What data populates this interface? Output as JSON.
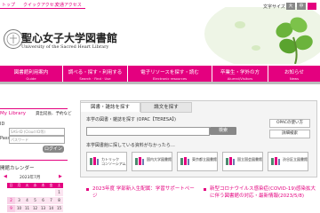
{
  "top_links": [
    "トップ",
    "クイックアクセス",
    "交通アクセス"
  ],
  "utility": {
    "font_size_label": "文字サイズ",
    "sizes": [
      "大",
      "中"
    ]
  },
  "logo": {
    "jp": "聖心女子大学図書館",
    "en": "University of the Sacred Heart Library"
  },
  "nav": [
    {
      "jp": "図書館利用案内",
      "en": "Guide"
    },
    {
      "jp": "調べる・探す・利用する",
      "en": "Search · Find · Use"
    },
    {
      "jp": "電子リソースを探す・読む",
      "en": "Electronic resources"
    },
    {
      "jp": "卒業生・学外の方",
      "en": "Alumni/Visitors"
    },
    {
      "jp": "お知らせ",
      "en": "News"
    }
  ],
  "sidebar": {
    "title": "My Library",
    "links": "貸出延長、予約など",
    "id_label": "ID",
    "id_placeholder": "SAS-ID (Cloud ID等)",
    "password_label": "Pass",
    "password_placeholder": "パスワード",
    "login": "ログイン",
    "calendar_title": "開館カレンダー",
    "month": "2023年7月",
    "weekdays": [
      "日",
      "月",
      "火",
      "水",
      "木",
      "金",
      "土"
    ],
    "days": [
      "",
      "",
      "",
      "",
      "",
      "",
      "1",
      "2",
      "3",
      "4",
      "5",
      "6",
      "7",
      "8",
      "9",
      "10",
      "11",
      "12",
      "13",
      "14",
      "15"
    ]
  },
  "search": {
    "tab_active": "図書・雑誌を探す",
    "tab_inactive": "論文を探す",
    "label1": "本学の図書・雑誌を探す (OPAC【TERESA】)",
    "search_btn": "検索",
    "label2": "本学図書館に探している資料がなかったら…",
    "opac_btn": "OPACの使い方",
    "detail_btn": "詳細検索",
    "libraries": [
      {
        "name": "カトリック\nコンソーシアム"
      },
      {
        "name": "国内大学図書館"
      },
      {
        "name": "東京都立図書館"
      },
      {
        "name": "国立国会図書館"
      },
      {
        "name": "渋谷区立図書館"
      }
    ]
  },
  "news": [
    {
      "text": "2023年度 学部新入生配属：学習サポートページ"
    },
    {
      "text": "新型コロナウイルス感染症(COVID-19)感染拡大に伴う図書館の対応・最新情報(2023/5/8)"
    }
  ],
  "colors": {
    "accent": "#e4007f"
  }
}
